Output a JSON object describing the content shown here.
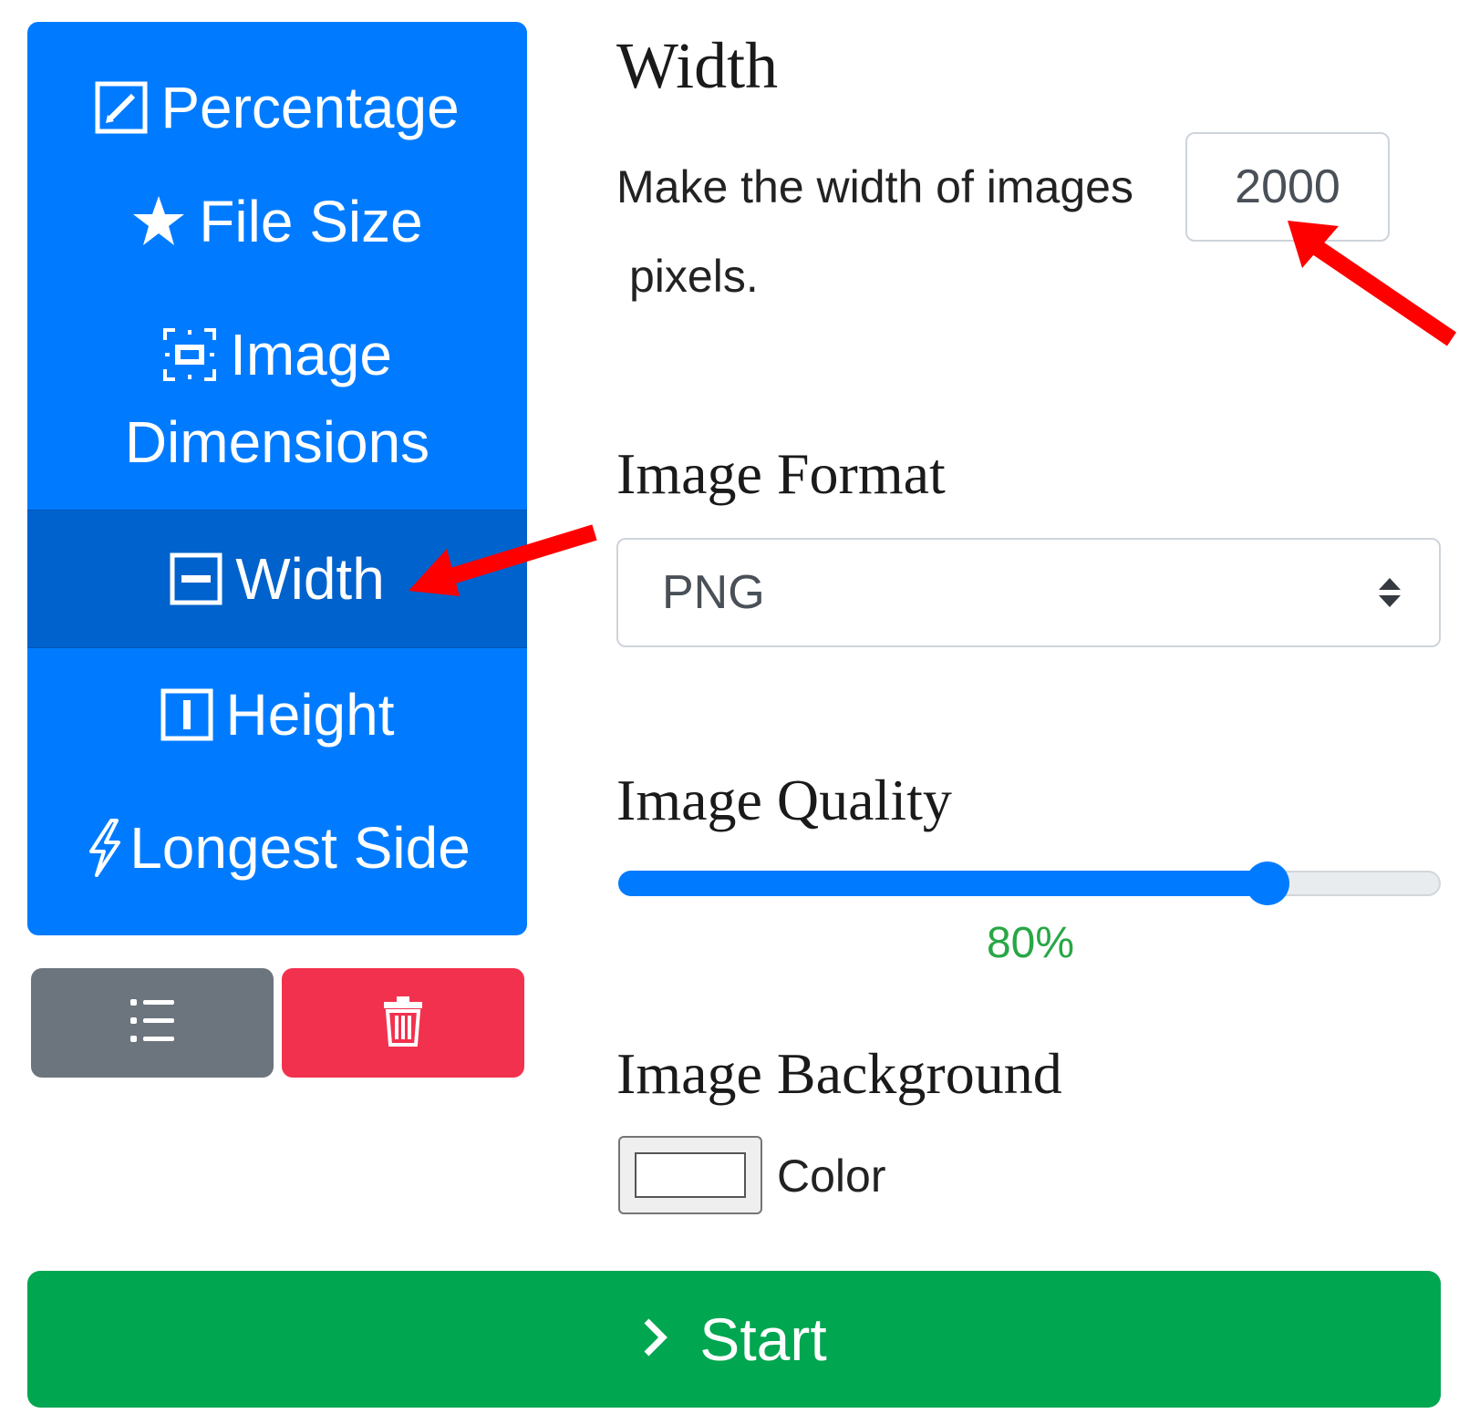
{
  "menu": {
    "items": [
      {
        "label": "Percentage",
        "icon": "pencil-square-icon",
        "active": false
      },
      {
        "label": "File Size",
        "icon": "star-icon",
        "active": false
      },
      {
        "label": "Image",
        "label_line2": "Dimensions",
        "icon": "bounding-box-icon",
        "active": false
      },
      {
        "label": "Width",
        "icon": "dash-square-icon",
        "active": true
      },
      {
        "label": "Height",
        "icon": "i-square-icon",
        "active": false
      },
      {
        "label": "Longest Side",
        "icon": "lightning-icon",
        "active": false
      }
    ],
    "colors": {
      "base": "#007bff",
      "active": "#0062cc"
    }
  },
  "actions": {
    "list_icon": "list-icon",
    "delete_icon": "trash-icon",
    "colors": {
      "list": "#6c757d",
      "delete": "#f2314e"
    }
  },
  "settings": {
    "width": {
      "heading": "Width",
      "text_before": "Make the width of images",
      "value": "2000",
      "text_after": "pixels."
    },
    "format": {
      "heading": "Image Format",
      "selected": "PNG"
    },
    "quality": {
      "heading": "Image Quality",
      "value": 80,
      "value_label": "80%"
    },
    "background": {
      "heading": "Image Background",
      "color_label": "Color",
      "color_value": "#ffffff"
    }
  },
  "start": {
    "label": "Start",
    "icon": "chevron-right-icon",
    "color": "#00a650"
  },
  "annotations": {
    "arrow_color": "#ff0000"
  }
}
